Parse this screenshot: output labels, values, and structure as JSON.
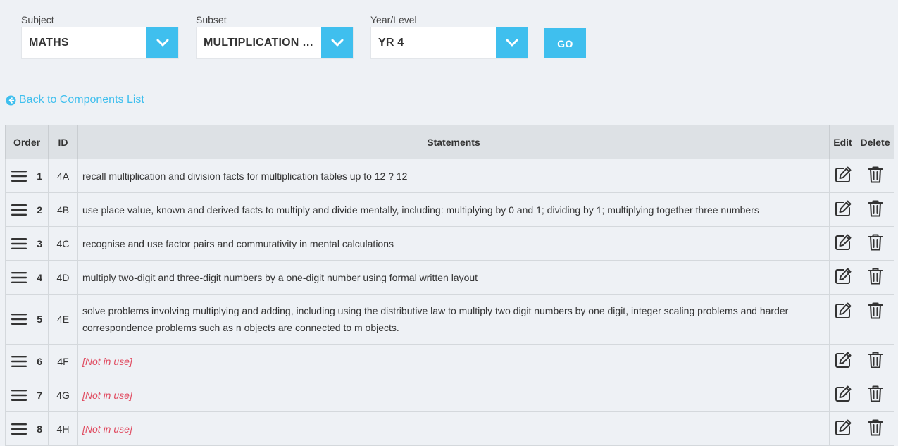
{
  "filters": {
    "subject": {
      "label": "Subject",
      "value": "MATHS"
    },
    "subset": {
      "label": "Subset",
      "value": "MULTIPLICATION & D..."
    },
    "year": {
      "label": "Year/Level",
      "value": "YR 4"
    },
    "go_label": "GO"
  },
  "back_link": "Back to Components List",
  "table": {
    "headers": {
      "order": "Order",
      "id": "ID",
      "statements": "Statements",
      "edit": "Edit",
      "delete": "Delete"
    },
    "rows": [
      {
        "order": "1",
        "id": "4A",
        "statement": "recall multiplication and division facts for multiplication tables up to 12 ? 12",
        "in_use": true
      },
      {
        "order": "2",
        "id": "4B",
        "statement": "use place value, known and derived facts to multiply and divide mentally, including: multiplying by 0 and 1; dividing by 1; multiplying together three numbers",
        "in_use": true
      },
      {
        "order": "3",
        "id": "4C",
        "statement": "recognise and use factor pairs and commutativity in mental calculations",
        "in_use": true
      },
      {
        "order": "4",
        "id": "4D",
        "statement": "multiply two-digit and three-digit numbers by a one-digit number using formal written layout",
        "in_use": true
      },
      {
        "order": "5",
        "id": "4E",
        "statement": "solve problems involving multiplying and adding, including using the distributive law to multiply two digit numbers by one digit, integer scaling problems and harder correspondence problems such as n objects are connected to m objects.",
        "in_use": true
      },
      {
        "order": "6",
        "id": "4F",
        "statement": "[Not in use]",
        "in_use": false
      },
      {
        "order": "7",
        "id": "4G",
        "statement": "[Not in use]",
        "in_use": false
      },
      {
        "order": "8",
        "id": "4H",
        "statement": "[Not in use]",
        "in_use": false
      }
    ]
  },
  "colors": {
    "accent": "#3fbfee",
    "not_in_use": "#e04a5f",
    "background": "#eef1f5",
    "header_bg": "#dde1e5"
  },
  "icons": {
    "drag": "drag-handle-icon",
    "edit": "edit-icon",
    "delete": "trash-icon",
    "back": "arrow-left-circle-icon",
    "dropdown": "chevron-down-icon"
  }
}
